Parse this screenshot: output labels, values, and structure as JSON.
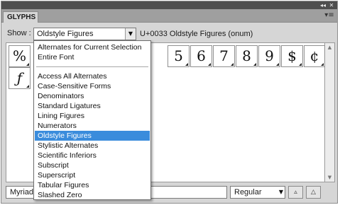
{
  "panel": {
    "tab_label": "GLYPHS",
    "collapse_glyph": "◂◂",
    "close_glyph": "✕",
    "menu_glyph": "▾≡"
  },
  "show": {
    "label": "Show :",
    "selected": "Oldstyle Figures",
    "unicode_info": "U+0033 Oldstyle Figures (onum)"
  },
  "glyphs": {
    "row1": [
      "%",
      "",
      "",
      "",
      "",
      "",
      "5",
      "6",
      "7",
      "8",
      "9",
      "$",
      "¢",
      "€"
    ],
    "row2": [
      "ƒ"
    ]
  },
  "dropdown": {
    "group1": [
      "Alternates for Current Selection",
      "Entire Font"
    ],
    "group2": [
      "Access All Alternates",
      "Case-Sensitive Forms",
      "Denominators",
      "Standard Ligatures",
      "Lining Figures",
      "Numerators",
      "Oldstyle Figures",
      "Stylistic Alternates",
      "Scientific Inferiors",
      "Subscript",
      "Superscript",
      "Tabular Figures",
      "Slashed Zero"
    ],
    "selected_item": "Oldstyle Figures"
  },
  "bottom": {
    "font_name": "Myriad",
    "font_style": "Regular"
  },
  "colors": {
    "highlight": "#3a8cdc",
    "panel_bg": "#d6d6d6",
    "topbar": "#4e4e4e"
  }
}
